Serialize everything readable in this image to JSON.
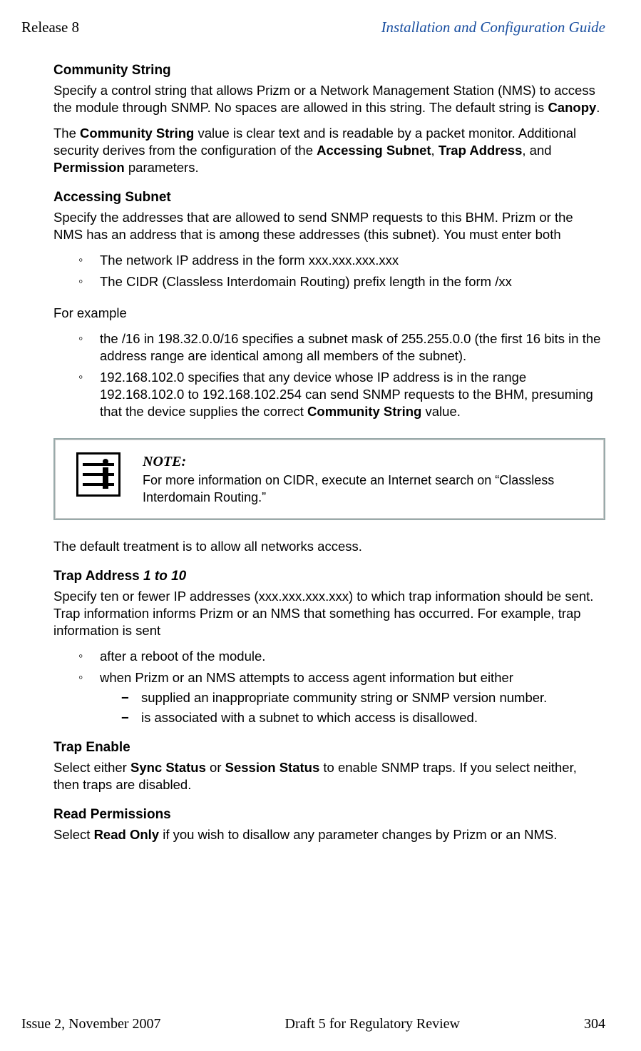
{
  "header": {
    "left": "Release 8",
    "right": "Installation and Configuration Guide"
  },
  "s1": {
    "heading": "Community String",
    "p1a": "Specify a control string that allows Prizm or a Network Management Station (NMS) to access the module through SNMP. No spaces are allowed in this string. The default string is ",
    "p1b": "Canopy",
    "p1c": ".",
    "p2a": "The ",
    "p2b": "Community String",
    "p2c": " value is clear text and is readable by a packet monitor. Additional security derives from the configuration of the ",
    "p2d": "Accessing Subnet",
    "p2e": ", ",
    "p2f": "Trap Address",
    "p2g": ", and ",
    "p2h": "Permission",
    "p2i": " parameters."
  },
  "s2": {
    "heading": "Accessing Subnet",
    "p1": "Specify the addresses that are allowed to send SNMP requests to this BHM. Prizm or the NMS has an address that is among these addresses (this subnet). You must enter both",
    "b1": "The network IP address in the form xxx.xxx.xxx.xxx",
    "b2": "The CIDR (Classless Interdomain Routing) prefix length in the form /xx",
    "p2": "For example",
    "b3": "the /16 in 198.32.0.0/16 specifies a subnet mask of 255.255.0.0 (the first 16 bits in the address range are identical among all members of the subnet).",
    "b4a": "192.168.102.0 specifies that any device whose IP address is in the range 192.168.102.0 to 192.168.102.254 can send SNMP requests to the BHM, presuming that the device supplies the correct ",
    "b4b": "Community String",
    "b4c": " value."
  },
  "note": {
    "title": "NOTE:",
    "text": "For more information on CIDR, execute an Internet search on “Classless Interdomain Routing.”"
  },
  "s3": {
    "p1": "The default treatment is to allow all networks access."
  },
  "s4": {
    "heading_a": "Trap Address ",
    "heading_b": "1 to 10",
    "p1": "Specify ten or fewer IP addresses (xxx.xxx.xxx.xxx) to which trap information should be sent. Trap information informs Prizm or an NMS that something has occurred. For example, trap information is sent",
    "b1": "after a reboot of the module.",
    "b2": "when Prizm or an NMS attempts to access agent information but either",
    "d1": "supplied an inappropriate community string or SNMP version number.",
    "d2": "is associated with a subnet to which access is disallowed."
  },
  "s5": {
    "heading": "Trap Enable",
    "p1a": "Select either ",
    "p1b": "Sync Status",
    "p1c": " or ",
    "p1d": "Session Status",
    "p1e": " to enable SNMP traps. If you select neither, then traps are disabled."
  },
  "s6": {
    "heading": "Read Permissions",
    "p1a": "Select ",
    "p1b": "Read Only",
    "p1c": " if you wish to disallow any parameter changes by Prizm or an NMS."
  },
  "footer": {
    "left": "Issue 2, November 2007",
    "center": "Draft 5 for Regulatory Review",
    "right": "304"
  }
}
